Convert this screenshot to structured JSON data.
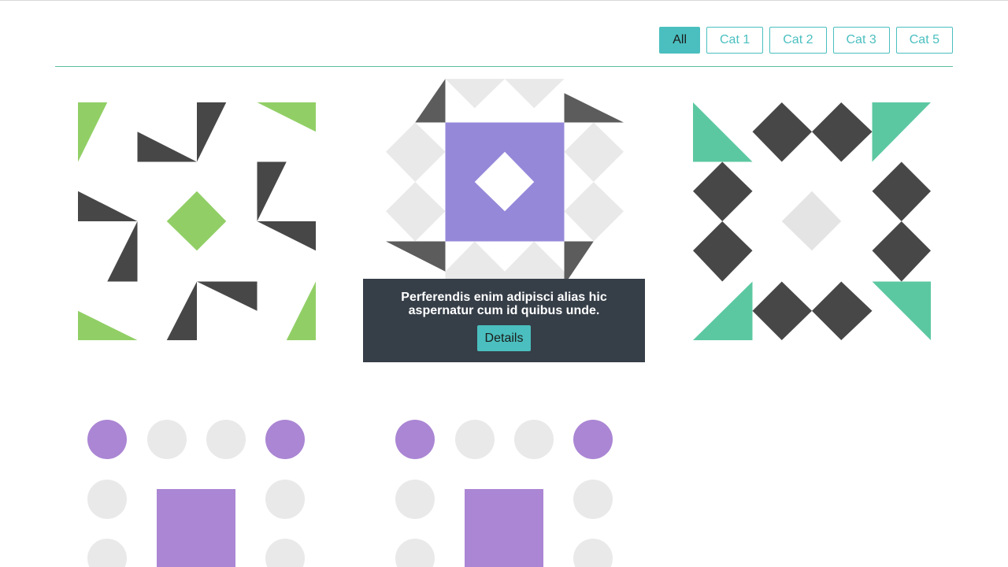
{
  "filters": [
    {
      "label": "All",
      "active": true
    },
    {
      "label": "Cat 1",
      "active": false
    },
    {
      "label": "Cat 2",
      "active": false
    },
    {
      "label": "Cat 3",
      "active": false
    },
    {
      "label": "Cat 5",
      "active": false
    }
  ],
  "colors": {
    "accent": "#4bbfbf",
    "divider": "#5cbfa0",
    "dark_shape": "#474747",
    "green_shape": "#91cf66",
    "purple_tile": "#9588d9",
    "light_gray": "#e9e9e9",
    "teal_shape": "#5cc8a2",
    "lavender_dot": "#ab86d4",
    "overlay_bg": "#363e48"
  },
  "portfolio": [
    {
      "name": "green-triangles-tile"
    },
    {
      "name": "purple-square-tile",
      "hover": {
        "description": "Perferendis enim adipisci alias hic aspernatur cum id quibus unde.",
        "button_label": "Details"
      }
    },
    {
      "name": "dark-diamonds-tile"
    },
    {
      "name": "lavender-dots-tile-1"
    },
    {
      "name": "lavender-dots-tile-2"
    }
  ]
}
